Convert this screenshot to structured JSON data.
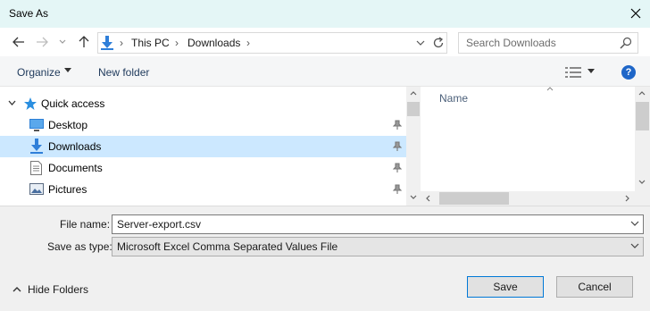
{
  "window": {
    "title": "Save As"
  },
  "nav": {
    "back_icon": "arrow-left-icon",
    "forward_icon": "arrow-right-icon",
    "up_icon": "arrow-up-icon",
    "breadcrumb": [
      "This PC",
      "Downloads"
    ],
    "search_placeholder": "Search Downloads"
  },
  "toolbar": {
    "organize_label": "Organize",
    "new_folder_label": "New folder",
    "help_label": "?"
  },
  "sidebar": {
    "items": [
      {
        "label": "Quick access",
        "icon": "star-icon"
      },
      {
        "label": "Desktop",
        "icon": "desktop-icon",
        "pinned": true
      },
      {
        "label": "Downloads",
        "icon": "download-icon",
        "pinned": true,
        "selected": true
      },
      {
        "label": "Documents",
        "icon": "document-icon",
        "pinned": true
      },
      {
        "label": "Pictures",
        "icon": "pictures-icon",
        "pinned": true
      }
    ]
  },
  "file_list": {
    "column_header": "Name"
  },
  "form": {
    "file_name_label": "File name:",
    "file_name_value": "Server-export.csv",
    "save_type_label": "Save as type:",
    "save_type_value": "Microsoft Excel Comma Separated Values File"
  },
  "footer": {
    "hide_folders_label": "Hide Folders",
    "save_label": "Save",
    "cancel_label": "Cancel"
  },
  "colors": {
    "selection": "#cce8ff",
    "accent": "#0078d7",
    "titlebar": "#e4f6f6"
  }
}
